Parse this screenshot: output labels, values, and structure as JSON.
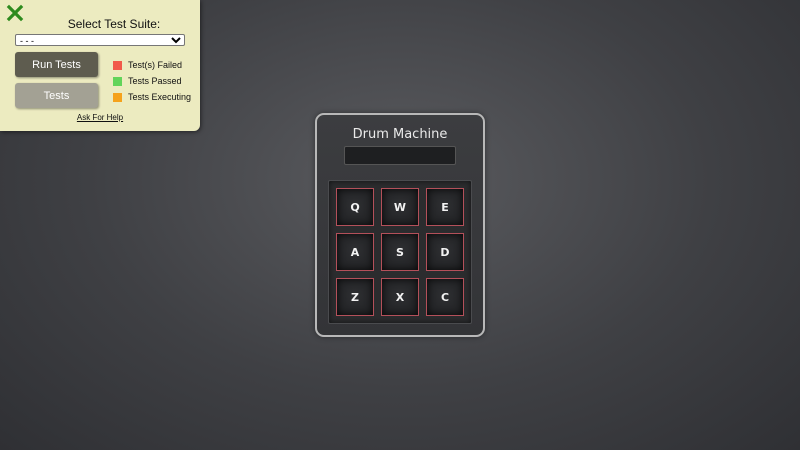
{
  "test_panel": {
    "title": "Select Test Suite:",
    "suite_select_value": "- - -",
    "run_button": "Run Tests",
    "tests_button": "Tests",
    "legend": [
      {
        "label": "Test(s) Failed",
        "color": "#f15a4a"
      },
      {
        "label": "Tests Passed",
        "color": "#62d45a"
      },
      {
        "label": "Tests Executing",
        "color": "#f5a21b"
      }
    ],
    "help_link": "Ask For Help",
    "close_icon": "close-x-icon",
    "close_icon_color": "#2e8b1e"
  },
  "drum_machine": {
    "title": "Drum Machine",
    "display_text": "",
    "pads": [
      "Q",
      "W",
      "E",
      "A",
      "S",
      "D",
      "Z",
      "X",
      "C"
    ],
    "pad_border_color": "#b4505a"
  }
}
